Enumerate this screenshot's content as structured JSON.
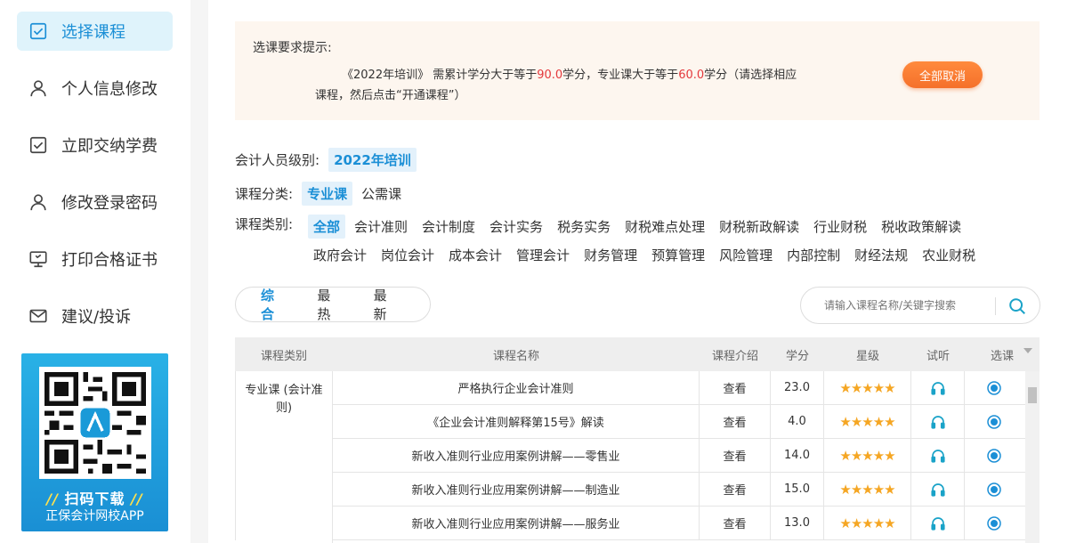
{
  "sidebar": {
    "items": [
      {
        "label": "选择课程",
        "icon": "checkbox-icon",
        "active": true
      },
      {
        "label": "个人信息修改",
        "icon": "user-icon"
      },
      {
        "label": "立即交纳学费",
        "icon": "checkbox-icon"
      },
      {
        "label": "修改登录密码",
        "icon": "user-icon"
      },
      {
        "label": "打印合格证书",
        "icon": "monitor-icon"
      },
      {
        "label": "建议/投诉",
        "icon": "mail-icon"
      }
    ],
    "qr": {
      "title": "扫码下载",
      "subtitle": "正保会计网校APP"
    }
  },
  "notice": {
    "title": "选课要求提示:",
    "line1_a": "《2022年培训》 需累计学分大于等于",
    "line1_b": "90.0",
    "line1_c": "学分，专业课大于等于",
    "line1_d": "60.0",
    "line1_e": "学分（请选择相应",
    "line2": "课程，然后点击“开通课程”）",
    "cancel_button": "全部取消"
  },
  "filters": {
    "level_label": "会计人员级别:",
    "level_value": "2022年培训",
    "class_label": "课程分类:",
    "class_options": [
      "专业课",
      "公需课"
    ],
    "type_label": "课程类别:",
    "type_row1": [
      "全部",
      "会计准则",
      "会计制度",
      "会计实务",
      "税务实务",
      "财税难点处理",
      "财税新政解读",
      "行业财税",
      "税收政策解读"
    ],
    "type_row2": [
      "政府会计",
      "岗位会计",
      "成本会计",
      "管理会计",
      "财务管理",
      "预算管理",
      "风险管理",
      "内部控制",
      "财经法规",
      "农业财税"
    ]
  },
  "sort": {
    "options": [
      "综合",
      "最热",
      "最新"
    ]
  },
  "search": {
    "placeholder": "请输入课程名称/关键字搜索"
  },
  "table": {
    "headers": [
      "课程类别",
      "课程名称",
      "课程介绍",
      "学分",
      "星级",
      "试听",
      "选课"
    ],
    "category": "专业课 (会计准则)",
    "view_label": "查看",
    "stars": "★★★★★",
    "rows": [
      {
        "name": "严格执行企业会计准则",
        "credit": "23.0"
      },
      {
        "name": "《企业会计准则解释第15号》解读",
        "credit": "4.0"
      },
      {
        "name": "新收入准则行业应用案例讲解——零售业",
        "credit": "14.0"
      },
      {
        "name": "新收入准则行业应用案例讲解——制造业",
        "credit": "15.0"
      },
      {
        "name": "新收入准则行业应用案例讲解——服务业",
        "credit": "13.0"
      }
    ]
  },
  "colors": {
    "accent": "#1b8fd6",
    "orange": "#f5702a",
    "red": "#e4393c",
    "star": "#f5a623"
  }
}
